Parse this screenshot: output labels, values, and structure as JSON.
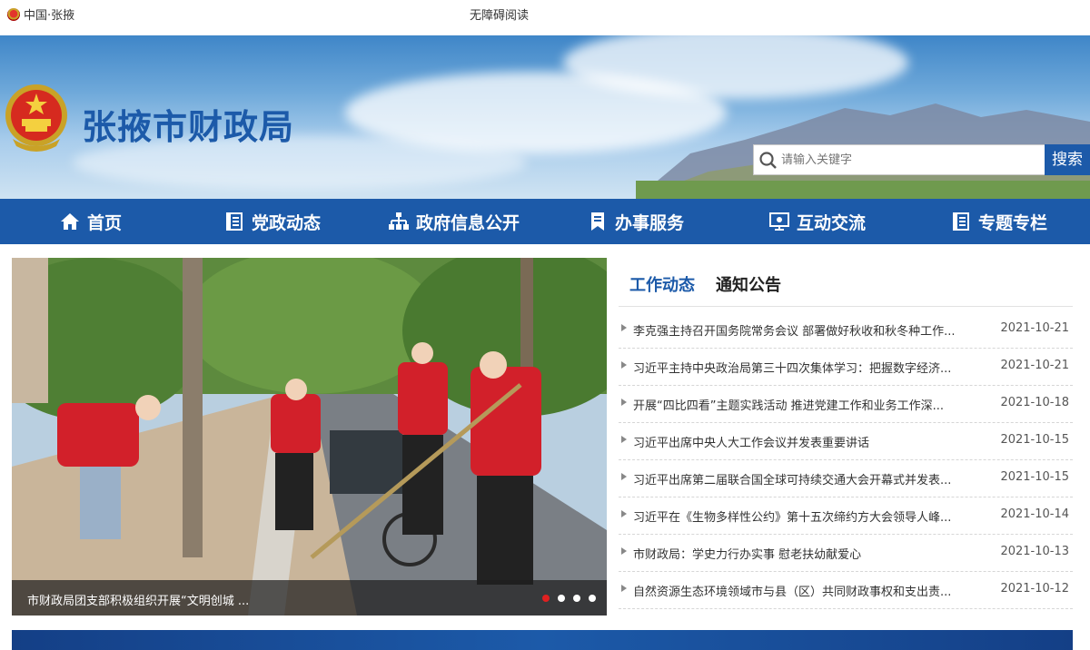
{
  "topbar": {
    "region": "中国·张掖",
    "accessibility": "无障碍阅读"
  },
  "header": {
    "site_title": "张掖市财政局",
    "search": {
      "placeholder": "请输入关键字",
      "button": "搜索"
    }
  },
  "nav": {
    "items": [
      {
        "label": "首页",
        "icon": "home-icon"
      },
      {
        "label": "党政动态",
        "icon": "document-icon"
      },
      {
        "label": "政府信息公开",
        "icon": "org-chart-icon"
      },
      {
        "label": "办事服务",
        "icon": "bookmark-icon"
      },
      {
        "label": "互动交流",
        "icon": "monitor-icon"
      },
      {
        "label": "专题专栏",
        "icon": "document-icon"
      }
    ]
  },
  "slider": {
    "caption": "市财政局团支部积极组织开展“文明创城 ...",
    "slide_count": 4,
    "active_index": 0
  },
  "news": {
    "tabs": [
      "工作动态",
      "通知公告"
    ],
    "active_tab": 0,
    "items": [
      {
        "title": "李克强主持召开国务院常务会议 部署做好秋收和秋冬种工作...",
        "date": "2021-10-21"
      },
      {
        "title": "习近平主持中央政治局第三十四次集体学习：把握数字经济...",
        "date": "2021-10-21"
      },
      {
        "title": "开展“四比四看”主题实践活动 推进党建工作和业务工作深...",
        "date": "2021-10-18"
      },
      {
        "title": "习近平出席中央人大工作会议并发表重要讲话",
        "date": "2021-10-15"
      },
      {
        "title": "习近平出席第二届联合国全球可持续交通大会开幕式并发表...",
        "date": "2021-10-15"
      },
      {
        "title": "习近平在《生物多样性公约》第十五次缔约方大会领导人峰...",
        "date": "2021-10-14"
      },
      {
        "title": "市财政局：学史力行办实事 慰老扶幼献爱心",
        "date": "2021-10-13"
      },
      {
        "title": "自然资源生态环境领域市与县（区）共同财政事权和支出责...",
        "date": "2021-10-12"
      }
    ]
  },
  "colors": {
    "brand_blue": "#1c5aa9",
    "active_dot": "#e02020"
  }
}
